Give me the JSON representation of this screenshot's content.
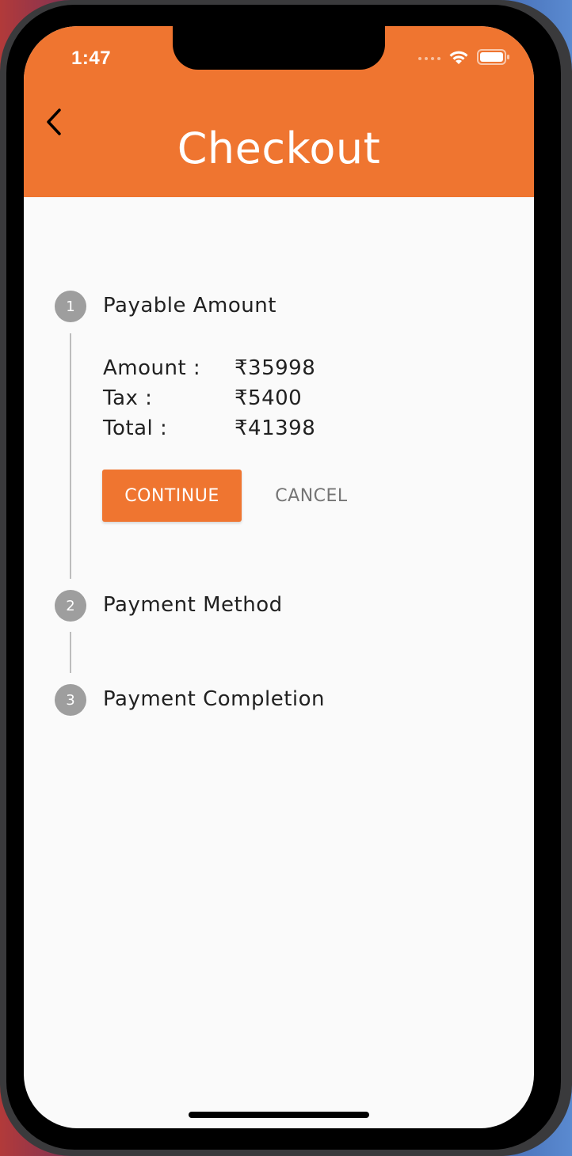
{
  "status_bar": {
    "time": "1:47"
  },
  "header": {
    "title": "Checkout",
    "background_color": "#ef7530"
  },
  "stepper": {
    "steps": [
      {
        "number": "1",
        "title": "Payable Amount"
      },
      {
        "number": "2",
        "title": "Payment Method"
      },
      {
        "number": "3",
        "title": "Payment Completion"
      }
    ],
    "active_step": {
      "rows": [
        {
          "label": "Amount :",
          "value": "₹35998"
        },
        {
          "label": "Tax :",
          "value": "₹5400"
        },
        {
          "label": "Total :",
          "value": "₹41398"
        }
      ],
      "continue_label": "CONTINUE",
      "cancel_label": "CANCEL"
    }
  },
  "icons": {
    "back": "chevron-left-icon",
    "wifi": "wifi-icon",
    "battery": "battery-icon",
    "signal": "signal-icon"
  }
}
